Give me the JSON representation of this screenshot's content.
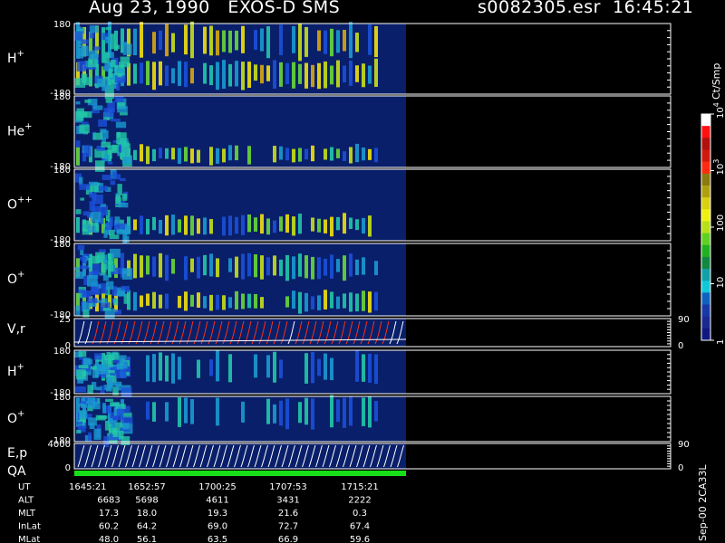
{
  "header": {
    "title": "Aug 23, 1990   EXOS-D SMS",
    "file_time": "s0082305.esr  16:45:21"
  },
  "colors": {
    "background": "#000000",
    "axes": "#ffffff",
    "data_bg": "#0a1f6a",
    "qa_bar": "#18e018",
    "velocity_trace": "#ff3010"
  },
  "chart_data": {
    "type": "heatmap",
    "panels": [
      {
        "id": "h_plus_1",
        "label": "H",
        "sup": "+",
        "ylim": [
          -180,
          180
        ],
        "yticks": [
          "180",
          "-180"
        ]
      },
      {
        "id": "he_plus",
        "label": "He",
        "sup": "+",
        "ylim": [
          -180,
          180
        ],
        "yticks": [
          "180",
          "-180"
        ]
      },
      {
        "id": "o_plus_plus",
        "label": "O",
        "sup": "++",
        "ylim": [
          -180,
          180
        ],
        "yticks": [
          "180",
          "-180"
        ]
      },
      {
        "id": "o_plus_1",
        "label": "O",
        "sup": "+",
        "ylim": [
          -180,
          180
        ],
        "yticks": [
          "180",
          "-180"
        ]
      },
      {
        "id": "v_r",
        "label": "V,r",
        "sup": "",
        "ylim": [
          0,
          25
        ],
        "yticks": [
          "25",
          "0"
        ],
        "right_ticks": [
          "90",
          "0"
        ]
      },
      {
        "id": "h_plus_2",
        "label": "H",
        "sup": "+",
        "ylim": [
          -180,
          180
        ],
        "yticks": [
          "180",
          "-180"
        ]
      },
      {
        "id": "o_plus_2",
        "label": "O",
        "sup": "+",
        "ylim": [
          -180,
          180
        ],
        "yticks": [
          "180",
          "-180"
        ]
      },
      {
        "id": "e_p",
        "label": "E,p",
        "sup": "",
        "ylim": [
          0,
          4000
        ],
        "yticks": [
          "4000",
          "0"
        ],
        "right_ticks": [
          "90",
          "0"
        ]
      },
      {
        "id": "qa",
        "label": "QA",
        "sup": "",
        "ylim": [
          0,
          1
        ],
        "yticks": []
      }
    ],
    "colorbar": {
      "label": "Ct/Smp",
      "scale": "log",
      "range": [
        1,
        10000
      ],
      "tick_labels": [
        "1",
        "10",
        "100",
        "10",
        "10"
      ],
      "tick_sups": [
        "",
        "",
        "",
        "3",
        "4"
      ]
    },
    "x_axis": {
      "rows": [
        {
          "label": "UT",
          "values": [
            "1645:21",
            "1652:57",
            "1700:25",
            "1707:53",
            "1715:21"
          ]
        },
        {
          "label": "ALT",
          "values": [
            "6683",
            "5698",
            "4611",
            "3431",
            "2222"
          ]
        },
        {
          "label": "MLT",
          "values": [
            "17.3",
            "18.0",
            "19.3",
            "21.6",
            "0.3"
          ]
        },
        {
          "label": "InLat",
          "values": [
            "60.2",
            "64.2",
            "69.0",
            "72.7",
            "67.4"
          ]
        },
        {
          "label": "MLat",
          "values": [
            "48.0",
            "56.1",
            "63.5",
            "66.9",
            "59.6"
          ]
        }
      ]
    },
    "footer_note": "Sep-00 2CA33L"
  }
}
